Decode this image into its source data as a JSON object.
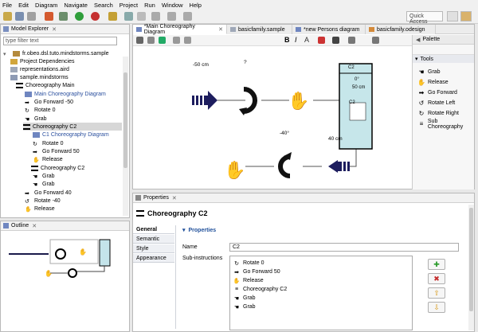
{
  "menu": [
    "File",
    "Edit",
    "Diagram",
    "Navigate",
    "Search",
    "Project",
    "Run",
    "Window",
    "Help"
  ],
  "quick_access": "Quick Access",
  "model_explorer": {
    "title": "Model Explorer",
    "filter_placeholder": "type filter text",
    "items": [
      {
        "label": "fr.obeo.dsl.tuto.mindstorms.sample"
      },
      {
        "label": "Project Dependencies"
      },
      {
        "label": "representations.aird"
      },
      {
        "label": "sample.mindstorms"
      },
      {
        "label": "Choreography Main"
      },
      {
        "label": "Main Choreography Diagram"
      },
      {
        "label": "Go Forward -50"
      },
      {
        "label": "Rotate 0"
      },
      {
        "label": "Grab"
      },
      {
        "label": "Choreography C2"
      },
      {
        "label": "C1 Choreography Diagram"
      },
      {
        "label": "Rotate 0"
      },
      {
        "label": "Go Forward 50"
      },
      {
        "label": "Release"
      },
      {
        "label": "Choreography C2"
      },
      {
        "label": "Grab"
      },
      {
        "label": "Grab"
      },
      {
        "label": "Go Forward 40"
      },
      {
        "label": "Rotate -40"
      },
      {
        "label": "Release"
      }
    ]
  },
  "outline": {
    "title": "Outline"
  },
  "editor_tabs": [
    "*Main Choreography Diagram",
    "basicfamily.sample",
    "*new Persons diagram",
    "basicfamily.odesign"
  ],
  "diagram": {
    "labels": {
      "go_back": "-50 cm",
      "rotate_q": "?",
      "rotate_neg": "-40°",
      "go_fwd": "40 cm"
    },
    "container": {
      "title": "C2",
      "rotate": "0°",
      "forward": "50 cm",
      "sub": "C2"
    }
  },
  "palette": {
    "title": "Palette",
    "section": "Tools",
    "tools": [
      "Grab",
      "Release",
      "Go Forward",
      "Rotate Left",
      "Rotate Right",
      "Sub Choreography"
    ]
  },
  "properties": {
    "view_title": "Properties",
    "heading": "Choreography C2",
    "tabs": [
      "General",
      "Semantic",
      "Style",
      "Appearance"
    ],
    "section": "Properties",
    "name_label": "Name",
    "name_value": "C2",
    "sub_label": "Sub-instructions",
    "sub_items": [
      "Rotate 0",
      "Go Forward 50",
      "Release",
      "Choreography C2",
      "Grab",
      "Grab"
    ]
  }
}
